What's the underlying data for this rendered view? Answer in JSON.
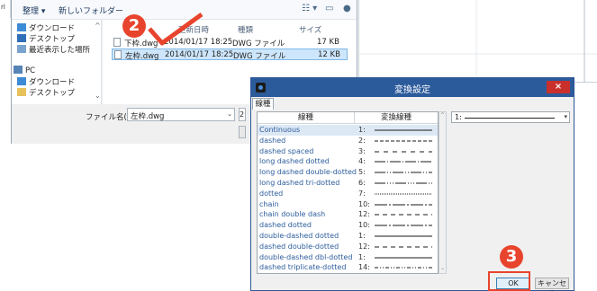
{
  "file_dialog": {
    "toolbar": {
      "organize": "整理 ▾",
      "new_folder": "新しいフォルダー"
    },
    "left_stub": "rl",
    "nav": [
      {
        "label": "ダウンロード",
        "icon": "download-folder-icon"
      },
      {
        "label": "デスクトップ",
        "icon": "desktop-icon"
      },
      {
        "label": "最近表示した場所",
        "icon": "recent-places-icon"
      },
      {
        "label": "PC",
        "icon": "pc-icon"
      },
      {
        "label": "ダウンロード",
        "icon": "download-folder-icon"
      },
      {
        "label": "デスクトップ",
        "icon": "desktop-icon"
      }
    ],
    "columns": {
      "date": "更新日時",
      "type": "種類",
      "size": "サイズ"
    },
    "files": [
      {
        "name": "下枠.dwg",
        "date": "2014/01/17 18:25",
        "type": "DWG ファイル",
        "size": "17 KB"
      },
      {
        "name": "左枠.dwg",
        "date": "2014/01/17 18:25",
        "type": "DWG ファイル",
        "size": "12 KB"
      }
    ],
    "filename_label": "ファイル名(N):",
    "filename_value": "左枠.dwg",
    "filter_stub": "2"
  },
  "callouts": {
    "step2": "2",
    "step3": "3"
  },
  "conv_dialog": {
    "title": "変換設定",
    "close": "×",
    "tab": "線種",
    "header": {
      "name": "線種",
      "conv": "変換線種"
    },
    "rows": [
      {
        "name": "Continuous",
        "num": "1:",
        "pattern": []
      },
      {
        "name": "dashed",
        "num": "2:",
        "pattern": [
          4,
          2
        ]
      },
      {
        "name": "dashed spaced",
        "num": "3:",
        "pattern": [
          5,
          5
        ]
      },
      {
        "name": "long dashed dotted",
        "num": "4:",
        "pattern": [
          12,
          2,
          1,
          2
        ]
      },
      {
        "name": "long dashed double-dotted",
        "num": "5:",
        "pattern": [
          12,
          2,
          1,
          2,
          1,
          2
        ]
      },
      {
        "name": "long dashed tri-dotted",
        "num": "6:",
        "pattern": [
          12,
          2,
          1,
          2,
          1,
          2,
          1,
          2
        ]
      },
      {
        "name": "dotted",
        "num": "7:",
        "pattern": [
          1,
          1
        ]
      },
      {
        "name": "chain",
        "num": "10:",
        "pattern": [
          14,
          2,
          2,
          2
        ]
      },
      {
        "name": "chain double dash",
        "num": "12:",
        "pattern": [
          5,
          4
        ]
      },
      {
        "name": "dashed dotted",
        "num": "10:",
        "pattern": [
          14,
          2,
          2,
          2
        ]
      },
      {
        "name": "double-dashed dotted",
        "num": "1:",
        "pattern": []
      },
      {
        "name": "dashed double-dotted",
        "num": "12:",
        "pattern": [
          5,
          4
        ]
      },
      {
        "name": "double-dashed dbl-dotted",
        "num": "1:",
        "pattern": []
      },
      {
        "name": "dashed triplicate-dotted",
        "num": "14:",
        "pattern": [
          4,
          2,
          1,
          2,
          1,
          2
        ]
      }
    ],
    "right_combo": {
      "num": "1:"
    },
    "ok": "OK",
    "cancel": "キャンセル"
  },
  "colors": {
    "callout": "#e8442d",
    "titlebar": "#2c5b9c",
    "close": "#c9302c",
    "linetype_name": "#2c5d9c"
  }
}
